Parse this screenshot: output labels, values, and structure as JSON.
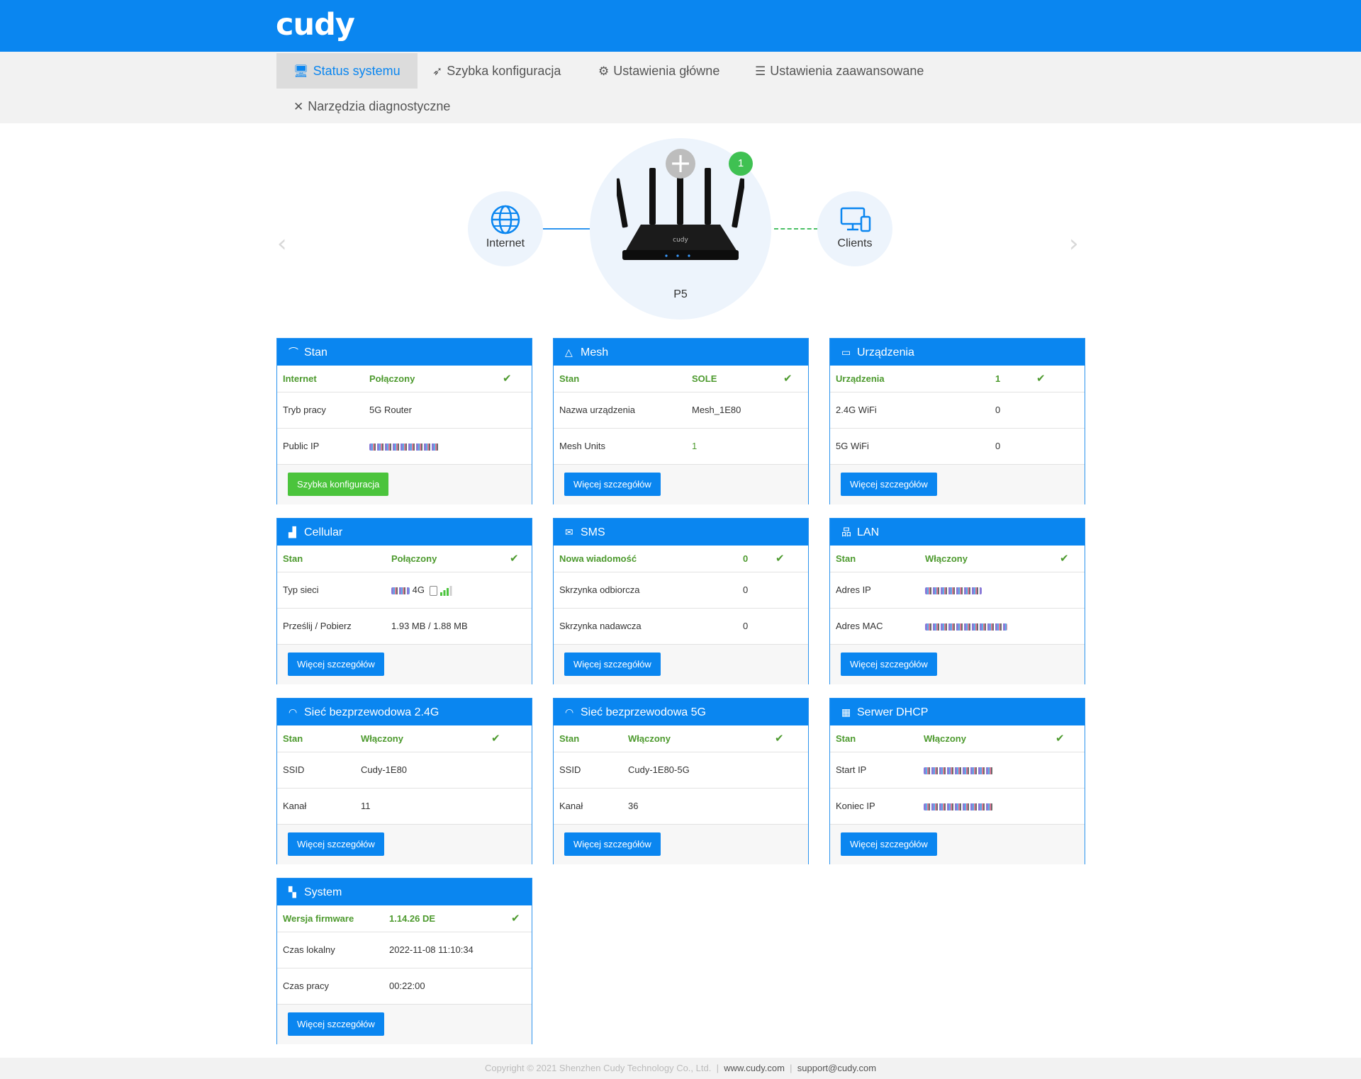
{
  "brand": {
    "logo": "cudy"
  },
  "nav": {
    "items": [
      {
        "label": "Status systemu",
        "icon": "monitor-icon"
      },
      {
        "label": "Szybka konfiguracja",
        "icon": "rocket-icon"
      },
      {
        "label": "Ustawienia główne",
        "icon": "gear-icon"
      },
      {
        "label": "Ustawienia zaawansowane",
        "icon": "sliders-icon"
      },
      {
        "label": "Narzędzia diagnostyczne",
        "icon": "tools-icon"
      }
    ]
  },
  "topology": {
    "internet_label": "Internet",
    "router_label": "P5",
    "router_logo": "cudy",
    "clients_label": "Clients",
    "plus": "+",
    "badge_count": "1",
    "prev_arrow": "‹",
    "next_arrow": "›"
  },
  "cards": {
    "stan": {
      "title": "Stan",
      "r0": {
        "k": "Internet",
        "v": "Połączony"
      },
      "r1": {
        "k": "Tryb pracy",
        "v": "5G Router"
      },
      "r2": {
        "k": "Public IP",
        "v": ""
      },
      "button": "Szybka konfiguracja"
    },
    "mesh": {
      "title": "Mesh",
      "r0": {
        "k": "Stan",
        "v": "SOLE"
      },
      "r1": {
        "k": "Nazwa urządzenia",
        "v": "Mesh_1E80"
      },
      "r2": {
        "k": "Mesh Units",
        "v": "1"
      },
      "button": "Więcej szczegółów"
    },
    "urzadzenia": {
      "title": "Urządzenia",
      "r0": {
        "k": "Urządzenia",
        "v": "1"
      },
      "r1": {
        "k": "2.4G WiFi",
        "v": "0"
      },
      "r2": {
        "k": "5G WiFi",
        "v": "0"
      },
      "button": "Więcej szczegółów"
    },
    "cellular": {
      "title": "Cellular",
      "r0": {
        "k": "Stan",
        "v": "Połączony"
      },
      "r1": {
        "k": "Typ sieci",
        "v": "4G"
      },
      "r2": {
        "k": "Prześlij / Pobierz",
        "v": "1.93 MB / 1.88 MB"
      },
      "button": "Więcej szczegółów"
    },
    "sms": {
      "title": "SMS",
      "r0": {
        "k": "Nowa wiadomość",
        "v": "0"
      },
      "r1": {
        "k": "Skrzynka odbiorcza",
        "v": "0"
      },
      "r2": {
        "k": "Skrzynka nadawcza",
        "v": "0"
      },
      "button": "Więcej szczegółów"
    },
    "lan": {
      "title": "LAN",
      "r0": {
        "k": "Stan",
        "v": "Włączony"
      },
      "r1": {
        "k": "Adres IP",
        "v": ""
      },
      "r2": {
        "k": "Adres MAC",
        "v": ""
      },
      "button": "Więcej szczegółów"
    },
    "wifi24": {
      "title": "Sieć bezprzewodowa 2.4G",
      "r0": {
        "k": "Stan",
        "v": "Włączony"
      },
      "r1": {
        "k": "SSID",
        "v": "Cudy-1E80"
      },
      "r2": {
        "k": "Kanał",
        "v": "11"
      },
      "button": "Więcej szczegółów"
    },
    "wifi5": {
      "title": "Sieć bezprzewodowa 5G",
      "r0": {
        "k": "Stan",
        "v": "Włączony"
      },
      "r1": {
        "k": "SSID",
        "v": "Cudy-1E80-5G"
      },
      "r2": {
        "k": "Kanał",
        "v": "36"
      },
      "button": "Więcej szczegółów"
    },
    "dhcp": {
      "title": "Serwer DHCP",
      "r0": {
        "k": "Stan",
        "v": "Włączony"
      },
      "r1": {
        "k": "Start IP",
        "v": ""
      },
      "r2": {
        "k": "Koniec IP",
        "v": ""
      },
      "button": "Więcej szczegółów"
    },
    "system": {
      "title": "System",
      "r0": {
        "k": "Wersja firmware",
        "v": "1.14.26 DE"
      },
      "r1": {
        "k": "Czas lokalny",
        "v": "2022-11-08 11:10:34"
      },
      "r2": {
        "k": "Czas pracy",
        "v": "00:22:00"
      },
      "button": "Więcej szczegółów"
    }
  },
  "footer": {
    "copyright": "Copyright © 2021 Shenzhen Cudy Technology Co., Ltd.",
    "sep": "|",
    "website": "www.cudy.com",
    "email": "support@cudy.com"
  },
  "colors": {
    "primary": "#0a86f0",
    "success": "#4d9a2e",
    "button_green": "#4bc43c"
  }
}
